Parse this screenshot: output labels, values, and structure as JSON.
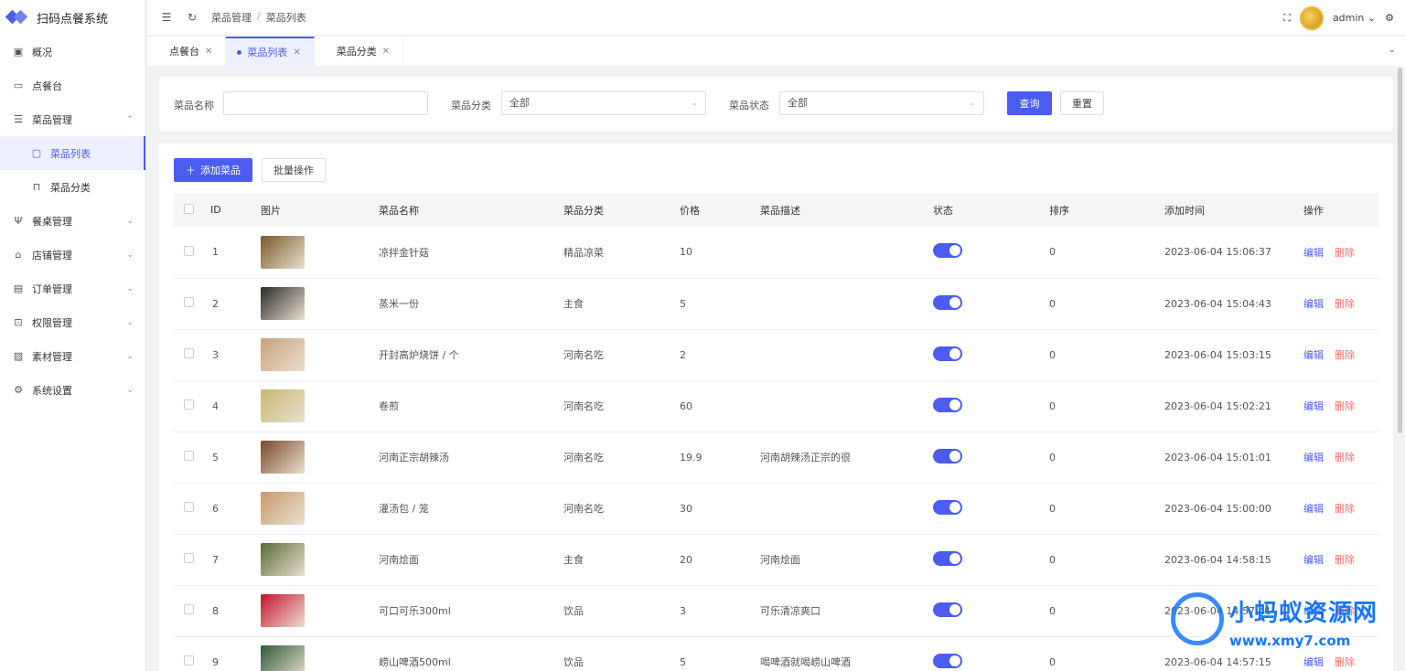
{
  "app": {
    "title": "扫码点餐系统"
  },
  "sidebar": {
    "items": [
      {
        "label": "概况",
        "icon": "dashboard-icon"
      },
      {
        "label": "点餐台",
        "icon": "monitor-icon"
      },
      {
        "label": "菜品管理",
        "icon": "menu-doc-icon",
        "expanded": true
      },
      {
        "label": "菜品列表",
        "icon": "message-icon",
        "active": true
      },
      {
        "label": "菜品分类",
        "icon": "bookmark-icon"
      },
      {
        "label": "餐桌管理",
        "icon": "fork-knife-icon"
      },
      {
        "label": "店铺管理",
        "icon": "shop-icon"
      },
      {
        "label": "订单管理",
        "icon": "order-icon"
      },
      {
        "label": "权限管理",
        "icon": "lock-icon"
      },
      {
        "label": "素材管理",
        "icon": "image-icon"
      },
      {
        "label": "系统设置",
        "icon": "gear-icon"
      }
    ]
  },
  "header": {
    "breadcrumb": [
      "菜品管理",
      "菜品列表"
    ],
    "user": "admin"
  },
  "tabs": [
    {
      "label": "点餐台"
    },
    {
      "label": "菜品列表",
      "active": true
    },
    {
      "label": "菜品分类"
    }
  ],
  "filter": {
    "name_label": "菜品名称",
    "name_value": "",
    "category_label": "菜品分类",
    "category_value": "全部",
    "status_label": "菜品状态",
    "status_value": "全部",
    "query_label": "查询",
    "reset_label": "重置"
  },
  "toolbar": {
    "add_label": "添加菜品",
    "batch_label": "批量操作"
  },
  "table": {
    "columns": [
      "ID",
      "图片",
      "菜品名称",
      "菜品分类",
      "价格",
      "菜品描述",
      "状态",
      "排序",
      "添加时间",
      "操作"
    ],
    "edit_label": "编辑",
    "delete_label": "删除",
    "rows": [
      {
        "id": "1",
        "name": "凉拌金针菇",
        "category": "精品凉菜",
        "price": "10",
        "desc": "",
        "enabled": true,
        "sort": "0",
        "time": "2023-06-04 15:06:37",
        "thumb": "#7a5a2a"
      },
      {
        "id": "2",
        "name": "蒸米一份",
        "category": "主食",
        "price": "5",
        "desc": "",
        "enabled": true,
        "sort": "0",
        "time": "2023-06-04 15:04:43",
        "thumb": "#2a2a2a"
      },
      {
        "id": "3",
        "name": "开封高炉烧饼 / 个",
        "category": "河南名吃",
        "price": "2",
        "desc": "",
        "enabled": true,
        "sort": "0",
        "time": "2023-06-04 15:03:15",
        "thumb": "#c9a07a"
      },
      {
        "id": "4",
        "name": "卷煎",
        "category": "河南名吃",
        "price": "60",
        "desc": "",
        "enabled": true,
        "sort": "0",
        "time": "2023-06-04 15:02:21",
        "thumb": "#c8b870"
      },
      {
        "id": "5",
        "name": "河南正宗胡辣汤",
        "category": "河南名吃",
        "price": "19.9",
        "desc": "河南胡辣汤正宗的很",
        "enabled": true,
        "sort": "0",
        "time": "2023-06-04 15:01:01",
        "thumb": "#7a4a2a"
      },
      {
        "id": "6",
        "name": "灌汤包 / 笼",
        "category": "河南名吃",
        "price": "30",
        "desc": "",
        "enabled": true,
        "sort": "0",
        "time": "2023-06-04 15:00:00",
        "thumb": "#c89a6a"
      },
      {
        "id": "7",
        "name": "河南烩面",
        "category": "主食",
        "price": "20",
        "desc": "河南烩面",
        "enabled": true,
        "sort": "0",
        "time": "2023-06-04 14:58:15",
        "thumb": "#5a6a3a"
      },
      {
        "id": "8",
        "name": "可口可乐300ml",
        "category": "饮品",
        "price": "3",
        "desc": "可乐清凉爽口",
        "enabled": true,
        "sort": "0",
        "time": "2023-06-04 14:57:41",
        "thumb": "#c8102e"
      },
      {
        "id": "9",
        "name": "崂山啤酒500ml",
        "category": "饮品",
        "price": "5",
        "desc": "喝啤酒就喝崂山啤酒",
        "enabled": true,
        "sort": "0",
        "time": "2023-06-04 14:57:15",
        "thumb": "#2e5a3a"
      }
    ]
  },
  "watermark": {
    "title": "小蚂蚁资源网",
    "url": "www.xmy7.com"
  },
  "colors": {
    "primary": "#4b5cf0",
    "danger": "#f56c6c"
  }
}
